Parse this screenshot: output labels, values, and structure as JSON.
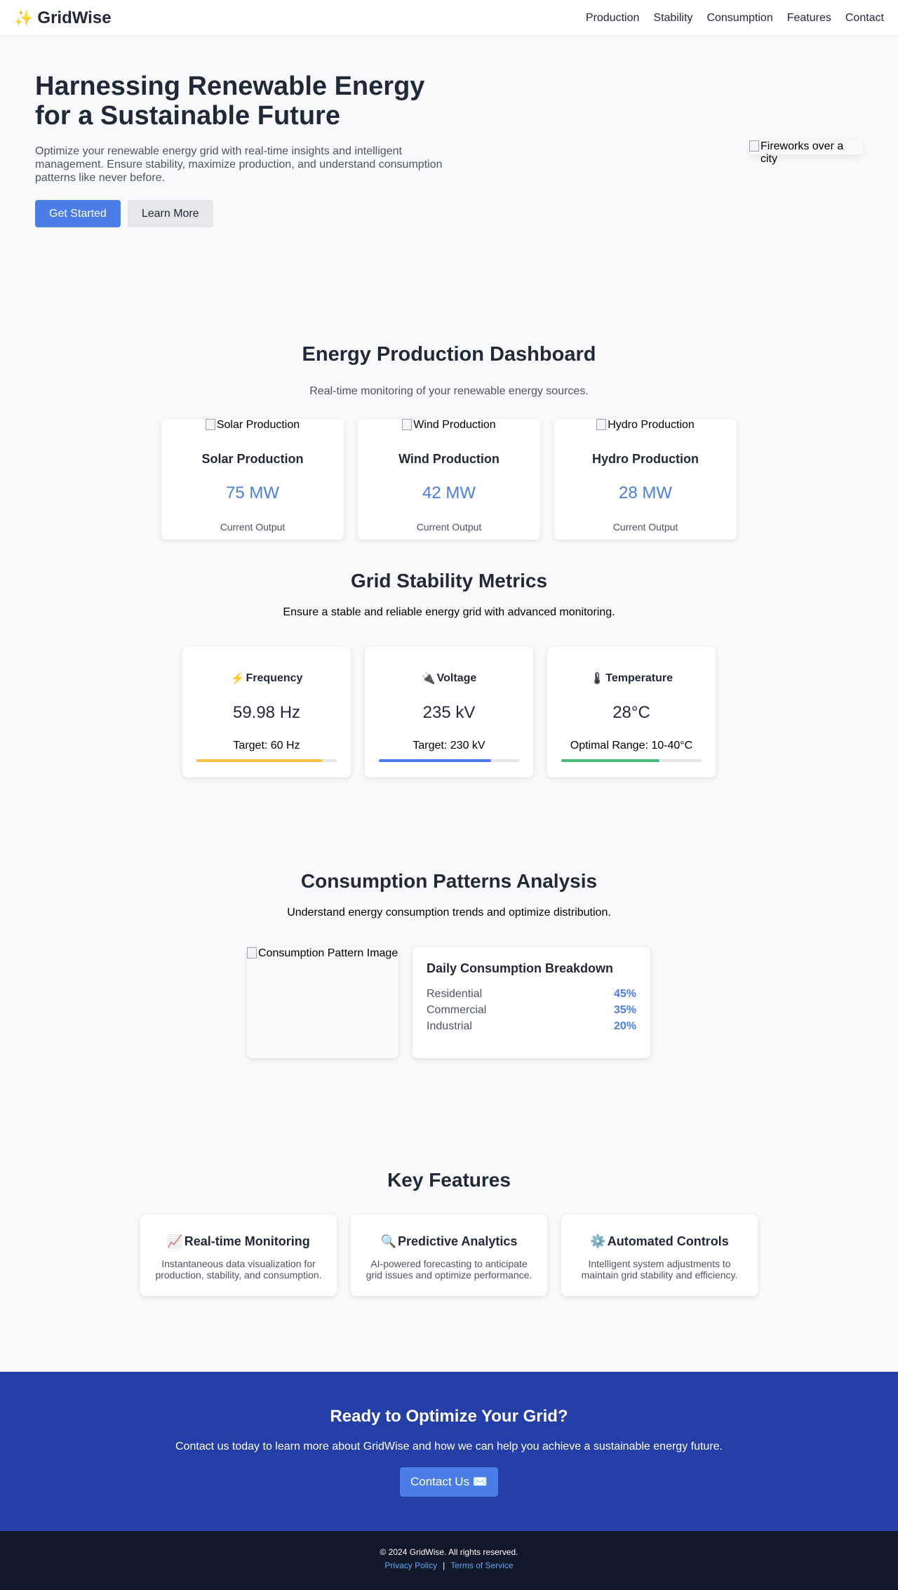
{
  "nav": {
    "brand_icon": "✨",
    "brand_name": "GridWise",
    "links": [
      "Production",
      "Stability",
      "Consumption",
      "Features",
      "Contact"
    ]
  },
  "hero": {
    "title": "Harnessing Renewable Energy for a Sustainable Future",
    "description": "Optimize your renewable energy grid with real-time insights and intelligent management. Ensure stability, maximize production, and understand consumption patterns like never before.",
    "primary_button": "Get Started",
    "secondary_button": "Learn More",
    "image_alt": "Fireworks over a city"
  },
  "production": {
    "title": "Energy Production Dashboard",
    "subtitle": "Real-time monitoring of your renewable energy sources.",
    "cards": [
      {
        "image_alt": "Solar Production",
        "title": "Solar Production",
        "value": "75 MW",
        "caption": "Current Output"
      },
      {
        "image_alt": "Wind Production",
        "title": "Wind Production",
        "value": "42 MW",
        "caption": "Current Output"
      },
      {
        "image_alt": "Hydro Production",
        "title": "Hydro Production",
        "value": "28 MW",
        "caption": "Current Output"
      }
    ]
  },
  "stability": {
    "title": "Grid Stability Metrics",
    "subtitle": "Ensure a stable and reliable energy grid with advanced monitoring.",
    "cards": [
      {
        "icon": "⚡",
        "icon_name": "lightning-icon",
        "title": "Frequency",
        "value": "59.98 Hz",
        "target": "Target: 60 Hz",
        "progress": 0.9,
        "color": "#f6c342"
      },
      {
        "icon": "🔌",
        "icon_name": "plug-icon",
        "title": "Voltage",
        "value": "235 kV",
        "target": "Target: 230 kV",
        "progress": 0.8,
        "color": "#4a7de8"
      },
      {
        "icon": "🌡",
        "icon_name": "thermometer-icon",
        "title": "Temperature",
        "value": "28°C",
        "target": "Optimal Range: 10-40°C",
        "progress": 0.7,
        "color": "#48bb78"
      }
    ]
  },
  "consumption": {
    "title": "Consumption Patterns Analysis",
    "subtitle": "Understand energy consumption trends and optimize distribution.",
    "image_alt": "Consumption Pattern Image",
    "breakdown_title": "Daily Consumption Breakdown",
    "rows": [
      {
        "label": "Residential",
        "value": "45%"
      },
      {
        "label": "Commercial",
        "value": "35%"
      },
      {
        "label": "Industrial",
        "value": "20%"
      }
    ]
  },
  "features": {
    "title": "Key Features",
    "cards": [
      {
        "icon": "📈",
        "icon_name": "chart-increasing-icon",
        "title": "Real-time Monitoring",
        "description": "Instantaneous data visualization for production, stability, and consumption."
      },
      {
        "icon": "🔍",
        "icon_name": "magnifier-icon",
        "title": "Predictive Analytics",
        "description": "AI-powered forecasting to anticipate grid issues and optimize performance."
      },
      {
        "icon": "⚙️",
        "icon_name": "gear-icon",
        "title": "Automated Controls",
        "description": "Intelligent system adjustments to maintain grid stability and efficiency."
      }
    ]
  },
  "cta": {
    "title": "Ready to Optimize Your Grid?",
    "description": "Contact us today to learn more about GridWise and how we can help you achieve a sustainable energy future.",
    "button": "Contact Us ✉️"
  },
  "footer": {
    "copyright": "© 2024 GridWise. All rights reserved.",
    "privacy": "Privacy Policy",
    "separator": "|",
    "terms": "Terms of Service"
  }
}
